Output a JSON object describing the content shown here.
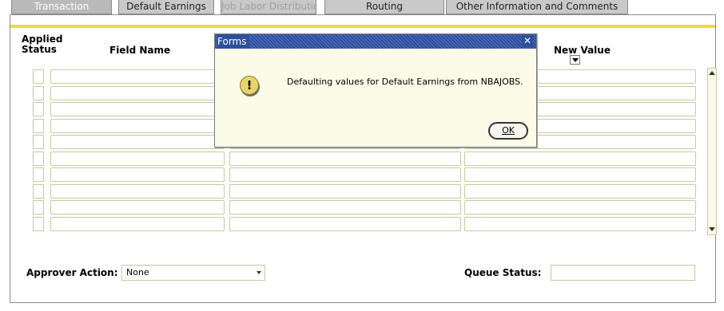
{
  "tabs": [
    {
      "label": "Transaction"
    },
    {
      "label": "Default Earnings"
    },
    {
      "label": "Job Labor Distribution"
    },
    {
      "label": "Routing"
    },
    {
      "label": "Other Information and Comments"
    }
  ],
  "grid": {
    "headers": {
      "applied_line1": "Applied",
      "applied_line2": "Status",
      "field_name": "Field Name",
      "new_value": "New Value"
    }
  },
  "footer": {
    "approver_action_label": "Approver Action:",
    "approver_action_value": "None",
    "queue_status_label": "Queue Status:",
    "queue_status_value": ""
  },
  "dialog": {
    "title": "Forms",
    "close_glyph": "✕",
    "icon_glyph": "!",
    "message": "Defaulting values for Default Earnings from NBAJOBS.",
    "ok_label": "OK"
  },
  "colors": {
    "accent_bar": "#e8d84a",
    "dialog_title_bg": "#2d4f9c",
    "dialog_bg": "#fbfbe8"
  }
}
